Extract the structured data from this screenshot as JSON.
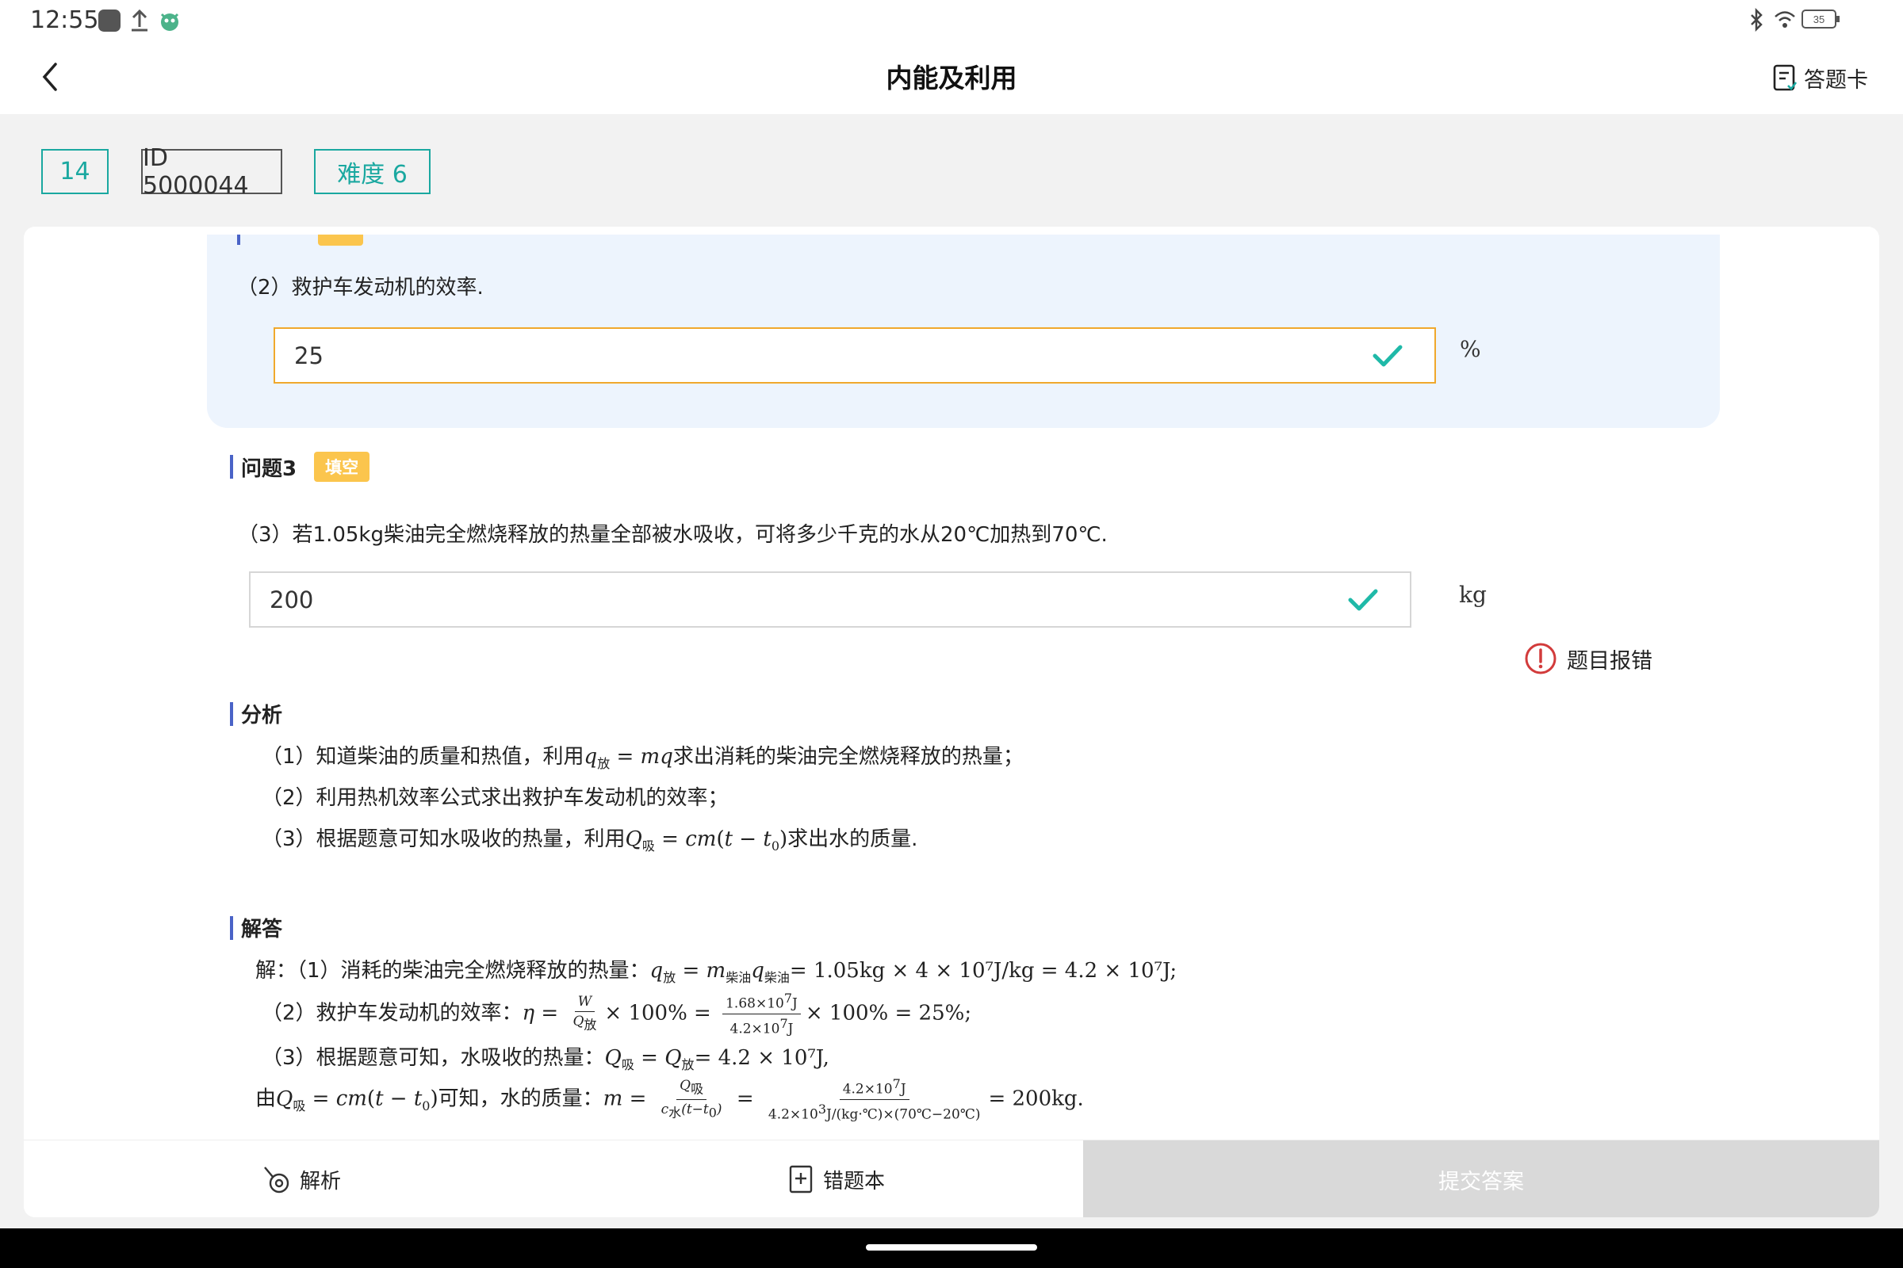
{
  "status_bar": {
    "time": "12:55",
    "battery": "35"
  },
  "header": {
    "title": "内能及利用",
    "answer_card_label": "答题卡"
  },
  "tags": {
    "number": "14",
    "id": "ID 5000044",
    "difficulty": "难度 6"
  },
  "question2": {
    "text": "（2）救护车发动机的效率.",
    "answer_value": "25",
    "unit": "%"
  },
  "question3": {
    "label": "问题3",
    "type_tag": "填空",
    "text": "（3）若1.05kg柴油完全燃烧释放的热量全部被水吸收，可将多少千克的水从20℃加热到70℃.",
    "answer_value": "200",
    "unit": "kg"
  },
  "report_label": "题目报错",
  "analysis": {
    "title": "分析",
    "line1_pre": "（1）知道柴油的质量和热值，利用",
    "line1_post": "求出消耗的柴油完全燃烧释放的热量；",
    "line2": "（2）利用热机效率公式求出救护车发动机的效率；",
    "line3_pre": "（3）根据题意可知水吸收的热量，利用",
    "line3_post": "求出水的质量."
  },
  "solution": {
    "title": "解答",
    "line1_pre": "解：（1）消耗的柴油完全燃烧释放的热量：",
    "line1_math": "= 1.05kg × 4 × 10⁷J/kg = 4.2 × 10⁷J;",
    "line2_pre": "（2）救护车发动机的效率：",
    "line2_tail": "× 100% = 25%;",
    "line3_pre": "（3）根据题意可知，水吸收的热量：",
    "line3_math": "= 4.2 × 10⁷J,",
    "line4_pre": "由",
    "line4_mid": "可知，水的质量：",
    "line4_tail": "= 200kg."
  },
  "bottom_bar": {
    "analysis_label": "解析",
    "wrong_book_label": "错题本",
    "submit_label": "提交答案"
  }
}
